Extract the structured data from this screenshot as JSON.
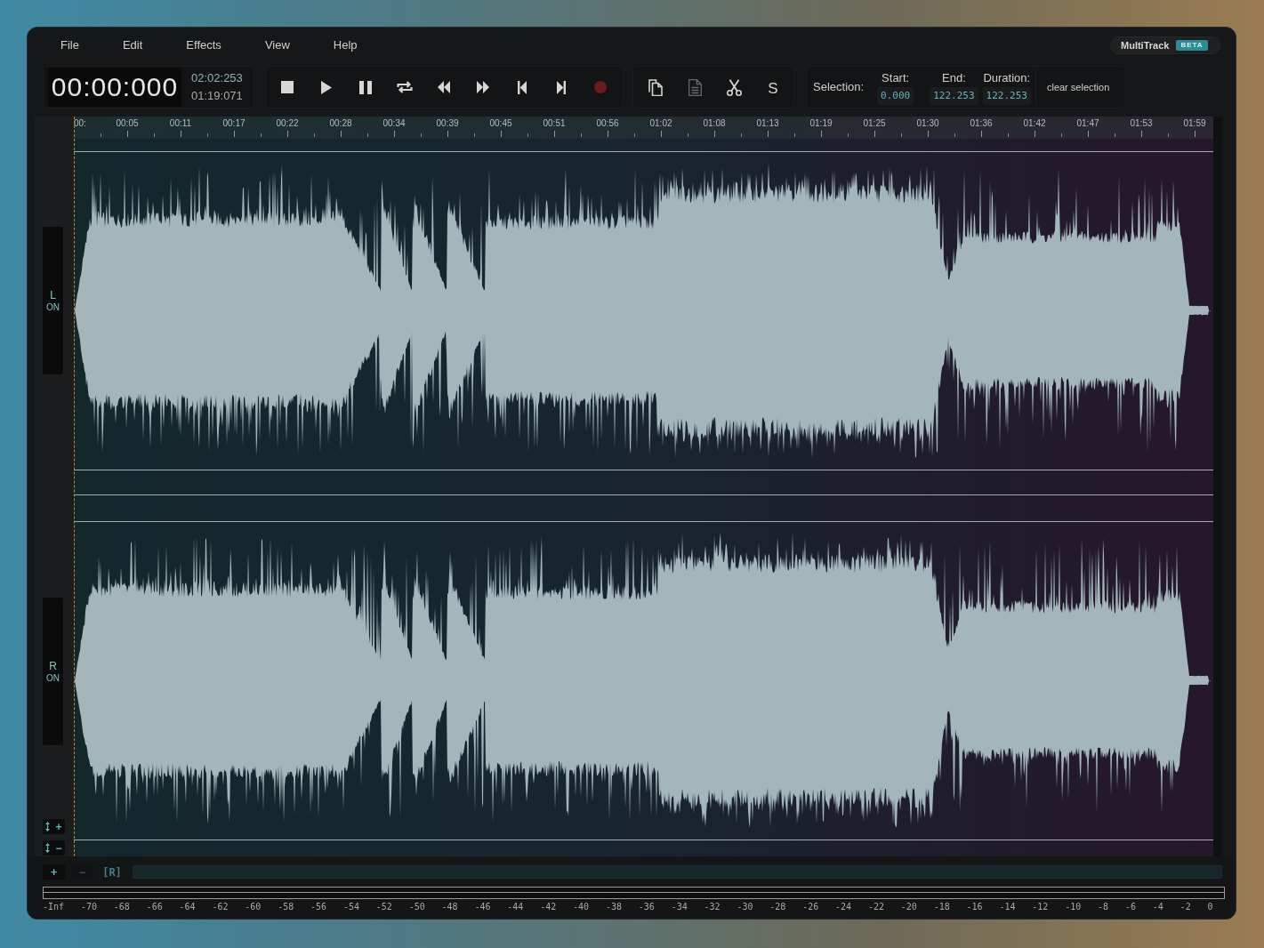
{
  "menu": [
    "File",
    "Edit",
    "Effects",
    "View",
    "Help"
  ],
  "app_badge": {
    "name": "MultiTrack",
    "tag": "BETA"
  },
  "clock": {
    "time": "00:00:000",
    "total": "02:02:253",
    "position": "01:19:071"
  },
  "edit_tools": [
    {
      "disabled": false
    },
    {
      "disabled": true
    },
    {
      "disabled": false
    },
    {
      "label": "S",
      "disabled": false
    }
  ],
  "selection": {
    "label": "Selection:",
    "fields": [
      {
        "label": "Start:",
        "value": "0.000"
      },
      {
        "label": "End:",
        "value": "122.253"
      },
      {
        "label": "Duration:",
        "value": "122.253"
      }
    ],
    "clear_button": "clear selection"
  },
  "ruler": [
    "00:",
    "00:05",
    "00:11",
    "00:17",
    "00:22",
    "00:28",
    "00:34",
    "00:39",
    "00:45",
    "00:51",
    "00:56",
    "01:02",
    "01:08",
    "01:13",
    "01:19",
    "01:25",
    "01:30",
    "01:36",
    "01:42",
    "01:47",
    "01:53",
    "01:59"
  ],
  "channels": [
    {
      "label": "L",
      "status": "ON"
    },
    {
      "label": "R",
      "status": "ON"
    }
  ],
  "height_buttons": [
    {
      "label": "+"
    },
    {
      "label": "−"
    }
  ],
  "zoom_buttons": [
    {
      "label": "+",
      "kind": "button",
      "disabled": false
    },
    {
      "label": "−",
      "kind": "button",
      "disabled": true
    },
    {
      "label": "[R]",
      "kind": "toggle",
      "on": false
    }
  ],
  "meter_scale": [
    "-Inf",
    "-70",
    "-68",
    "-66",
    "-64",
    "-62",
    "-60",
    "-58",
    "-56",
    "-54",
    "-52",
    "-50",
    "-48",
    "-46",
    "-44",
    "-42",
    "-40",
    "-38",
    "-36",
    "-34",
    "-32",
    "-30",
    "-28",
    "-26",
    "-24",
    "-22",
    "-20",
    "-18",
    "-16",
    "-14",
    "-12",
    "-10",
    "-8",
    "-6",
    "-4",
    "-2",
    "0"
  ]
}
